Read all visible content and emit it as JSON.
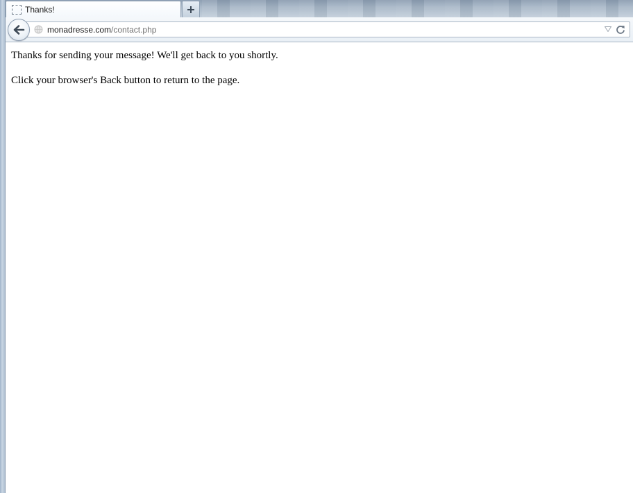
{
  "browser": {
    "tab": {
      "title": "Thanks!"
    },
    "url": {
      "host": "monadresse.com",
      "path": "/contact.php"
    }
  },
  "page": {
    "paragraphs": [
      "Thanks for sending your message! We'll get back to you shortly.",
      "Click your browser's Back button to return to the page."
    ]
  }
}
